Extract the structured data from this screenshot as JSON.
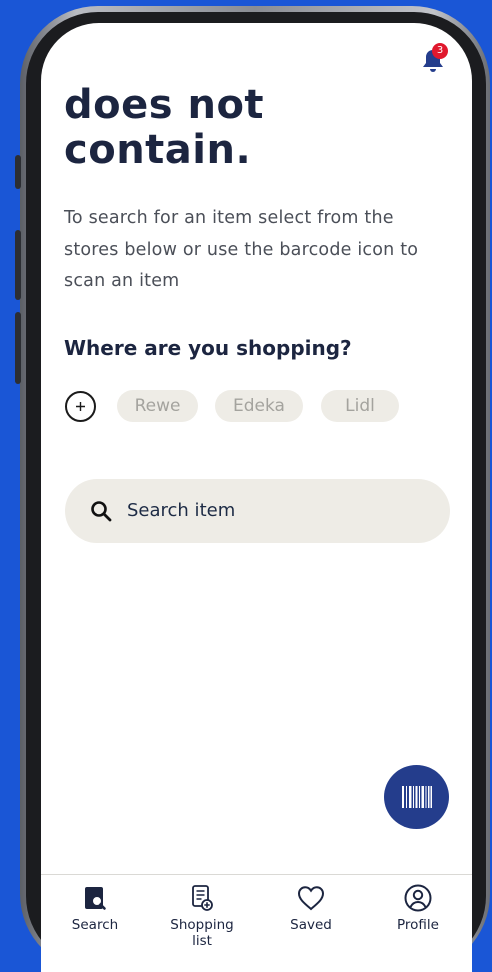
{
  "colors": {
    "background": "#1a56d6",
    "title": "#1c2540",
    "chip_bg": "#eeece6",
    "fab": "#243d8c",
    "badge": "#e0182d"
  },
  "header": {
    "notification_count": "3"
  },
  "title_lines": [
    "does not",
    "contain."
  ],
  "description_lines": [
    "To search for an item select from the",
    "stores below or use the barcode icon to",
    "scan an item"
  ],
  "stores": {
    "heading": "Where are you shopping?",
    "items": [
      "Rewe",
      "Edeka",
      "Lidl"
    ]
  },
  "search": {
    "placeholder": "Search item"
  },
  "nav": [
    {
      "label": "Search",
      "icon": "search-doc-icon"
    },
    {
      "label": "Shopping\nlist",
      "icon": "list-add-icon"
    },
    {
      "label": "Saved",
      "icon": "heart-icon"
    },
    {
      "label": "Profile",
      "icon": "user-circle-icon"
    }
  ]
}
